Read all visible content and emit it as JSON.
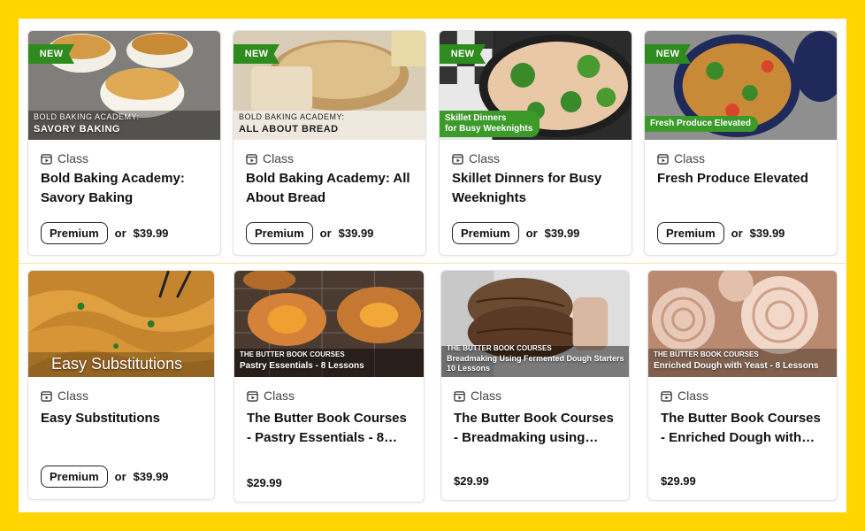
{
  "cards": [
    {
      "badge": "NEW",
      "overlay_line1": "BOLD BAKING ACADEMY:",
      "overlay_line2": "SAVORY BAKING",
      "type": "Class",
      "title": "Bold Baking Academy: Savory Baking",
      "premium": "Premium",
      "or": "or",
      "price": "$39.99"
    },
    {
      "badge": "NEW",
      "overlay_line1": "BOLD BAKING ACADEMY:",
      "overlay_line2": "ALL ABOUT BREAD",
      "type": "Class",
      "title": "Bold Baking Academy: All About Bread",
      "premium": "Premium",
      "or": "or",
      "price": "$39.99"
    },
    {
      "badge": "NEW",
      "overlay_tag_line1": "Skillet Dinners",
      "overlay_tag_line2": "for Busy Weeknights",
      "type": "Class",
      "title": "Skillet Dinners for Busy Weeknights",
      "premium": "Premium",
      "or": "or",
      "price": "$39.99"
    },
    {
      "badge": "NEW",
      "overlay_tag_line1": "Fresh Produce Elevated",
      "type": "Class",
      "title": "Fresh Produce Elevated",
      "premium": "Premium",
      "or": "or",
      "price": "$39.99"
    },
    {
      "overlay_big": "Easy Substitutions",
      "type": "Class",
      "title": "Easy Substitutions",
      "premium": "Premium",
      "or": "or",
      "price": "$39.99"
    },
    {
      "overlay_line1": "THE BUTTER BOOK COURSES",
      "overlay_line2": "Pastry Essentials - 8 Lessons",
      "type": "Class",
      "title": "The Butter Book Courses - Pastry Essentials - 8…",
      "price": "$29.99"
    },
    {
      "overlay_line1": "THE BUTTER BOOK COURSES",
      "overlay_line2": "Breadmaking Using Fermented Dough Starters",
      "overlay_line3": "10 Lessons",
      "type": "Class",
      "title": "The Butter Book Courses - Breadmaking using…",
      "price": "$29.99"
    },
    {
      "overlay_line1": "THE BUTTER BOOK COURSES",
      "overlay_line2": "Enriched Dough with Yeast - 8 Lessons",
      "type": "Class",
      "title": "The Butter Book Courses - Enriched Dough with…",
      "price": "$29.99"
    }
  ],
  "colors": {
    "frame": "#FFD400",
    "new_badge": "#2E8B1E",
    "tag": "#3C9A2A"
  }
}
